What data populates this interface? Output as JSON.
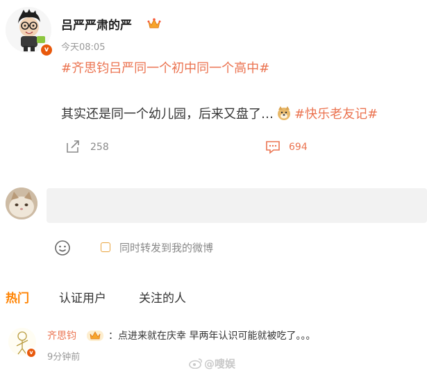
{
  "post": {
    "author": "吕严严肃的严",
    "time": "今天08:05",
    "topic": "#齐思钧吕严同一个初中同一个高中#",
    "body_text": "其实还是同一个幼儿园，后来又盘了…",
    "body_topic": "#快乐老友记#",
    "repost_count": "258",
    "comment_count": "694"
  },
  "composer": {
    "sync_repost_label": "同时转发到我的微博"
  },
  "tabs": [
    {
      "label": "热门"
    },
    {
      "label": "认证用户"
    },
    {
      "label": "关注的人"
    }
  ],
  "comments": [
    {
      "author": "齐思钧",
      "text": "：点进来就在庆幸 早两年认识可能就被吃了。。。",
      "time": "9分钟前"
    }
  ],
  "watermark": "@嗖娱",
  "colors": {
    "accent": "#ff8200",
    "topic": "#eb7350"
  }
}
